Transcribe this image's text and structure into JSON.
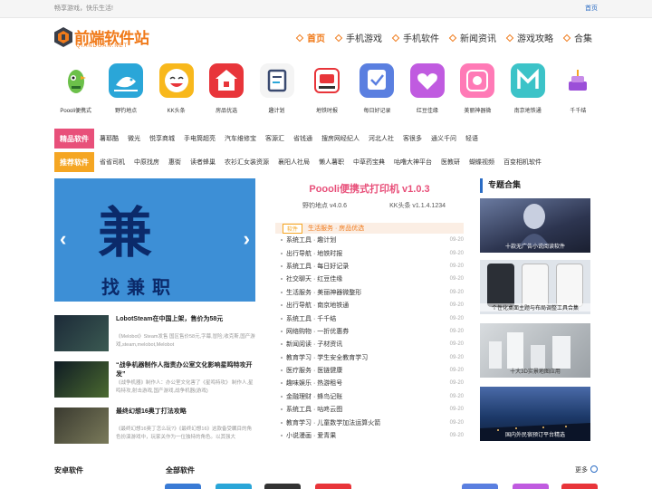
{
  "topbar": {
    "slogan": "畅享游戏，快乐生活!",
    "home": "首页"
  },
  "logo": {
    "name": "前端软件站",
    "sub": "QIANDUAN.NET"
  },
  "nav": [
    {
      "label": "首页",
      "active": true
    },
    {
      "label": "手机游戏"
    },
    {
      "label": "手机软件"
    },
    {
      "label": "新闻资讯"
    },
    {
      "label": "游戏攻略"
    },
    {
      "label": "合集"
    }
  ],
  "apps": [
    {
      "label": "Poooli便携式",
      "color": "#ffffff"
    },
    {
      "label": "野钓地点",
      "color": "#2aa6d8"
    },
    {
      "label": "KK头条",
      "color": "#f8b81c"
    },
    {
      "label": "房品优选",
      "color": "#e8353a"
    },
    {
      "label": "趣计划",
      "color": "#f4f4f4"
    },
    {
      "label": "地铁时报",
      "color": "#ffffff"
    },
    {
      "label": "每日好记录",
      "color": "#5a7fe0"
    },
    {
      "label": "红豆佳缘",
      "color": "#c05be0"
    },
    {
      "label": "美丽神器微",
      "color": "#ff7ab6"
    },
    {
      "label": "南京地铁通",
      "color": "#3cc3c8"
    },
    {
      "label": "千千结",
      "color": "#ffffff"
    }
  ],
  "row1": {
    "badge": "精品软件",
    "items": [
      "薯耶酷",
      "微光",
      "悦享商城",
      "手电筒超亮",
      "汽车维修宝",
      "客源汇",
      "省钱通",
      "搜房网经纪人",
      "河北人社",
      "客很多",
      "通义千问",
      "轻语"
    ]
  },
  "row2": {
    "badge": "推荐软件",
    "items": [
      "省省司机",
      "中原找房",
      "惠街",
      "读者蜂巢",
      "农衫汇女装资源",
      "襄阳人社局",
      "懒人薯职",
      "中草药宝典",
      "咕噜大神平台",
      "医教研",
      "蝴蝶视频",
      "百变相机软件"
    ]
  },
  "banner": {
    "big": "兼",
    "small": "找兼职",
    "left": "‹",
    "right": "›"
  },
  "news": [
    {
      "title": "LobotSteam在中国上架，售价为58元",
      "desc": "《Melobot》Steam发售 国区售价58元,字幕,冒险,收克斯,国产游戏,steam,melobot,Melobot"
    },
    {
      "title": "“战争机器制作人指责办公室文化影响星鸣特攻开发”",
      "desc": "《战争机器》制作人：办公室文化害了《星鸣特攻》 制作人,星鸣特攻,射击游戏,国产游戏,战争机器(游戏)"
    },
    {
      "title": "最终幻想16奥丁打法攻略",
      "desc": "《最终幻想16奥丁怎么玩?》《最终幻想16》这款备受瞩目的角色扮演游戏中，玩家关作为一位独特的角色。以其强大"
    }
  ],
  "center": {
    "title": "Poooli便携式打印机 v1.0.3",
    "v1": "野钓地点 v4.0.6",
    "v2": "KK头条 v1.1.4.1234",
    "tag": "软件",
    "section": "生活服务 · 房品优选",
    "list": [
      {
        "t": "系统工具 · 趣计划",
        "d": "09-20"
      },
      {
        "t": "出行导航 · 地铁时报",
        "d": "09-20"
      },
      {
        "t": "系统工具 · 每日好记录",
        "d": "09-20"
      },
      {
        "t": "社交聊天 · 红豆佳缘",
        "d": "09-20"
      },
      {
        "t": "生活服务 · 美丽神器微整形",
        "d": "09-20"
      },
      {
        "t": "出行导航 · 南京地铁通",
        "d": "09-20"
      },
      {
        "t": "系统工具 · 千千结",
        "d": "09-20"
      },
      {
        "t": "网络购物 · 一折优惠券",
        "d": "09-20"
      },
      {
        "t": "新闻阅读 · 子材资讯",
        "d": "09-20"
      },
      {
        "t": "教育学习 · 学生安全教育学习",
        "d": "09-20"
      },
      {
        "t": "医疗服务 · 医链健康",
        "d": "09-20"
      },
      {
        "t": "趣味娱乐 · 热游租号",
        "d": "09-20"
      },
      {
        "t": "金融理财 · 蜂鸟记账",
        "d": "09-20"
      },
      {
        "t": "系统工具 · 咕咚云图",
        "d": "09-20"
      },
      {
        "t": "教育学习 · 儿童数学加法运算火箭",
        "d": "09-20"
      },
      {
        "t": "小说漫画 · 爱青果",
        "d": "09-20"
      }
    ]
  },
  "right": {
    "head": "专题合集",
    "topics": [
      {
        "cap": "十款无广告小说阅读软件",
        "color": "#2d3550"
      },
      {
        "cap": "个性化桌面主题与布局调整工具合集",
        "color": "#dfe4ea"
      },
      {
        "cap": "十大3D实景地图应用",
        "color": "#b8bcc0"
      },
      {
        "cap": "国内外民宿预订平台精选",
        "color": "#1d3a6a"
      }
    ]
  },
  "bottom": {
    "a": "安卓软件",
    "b": "全部软件",
    "more": "更多"
  }
}
